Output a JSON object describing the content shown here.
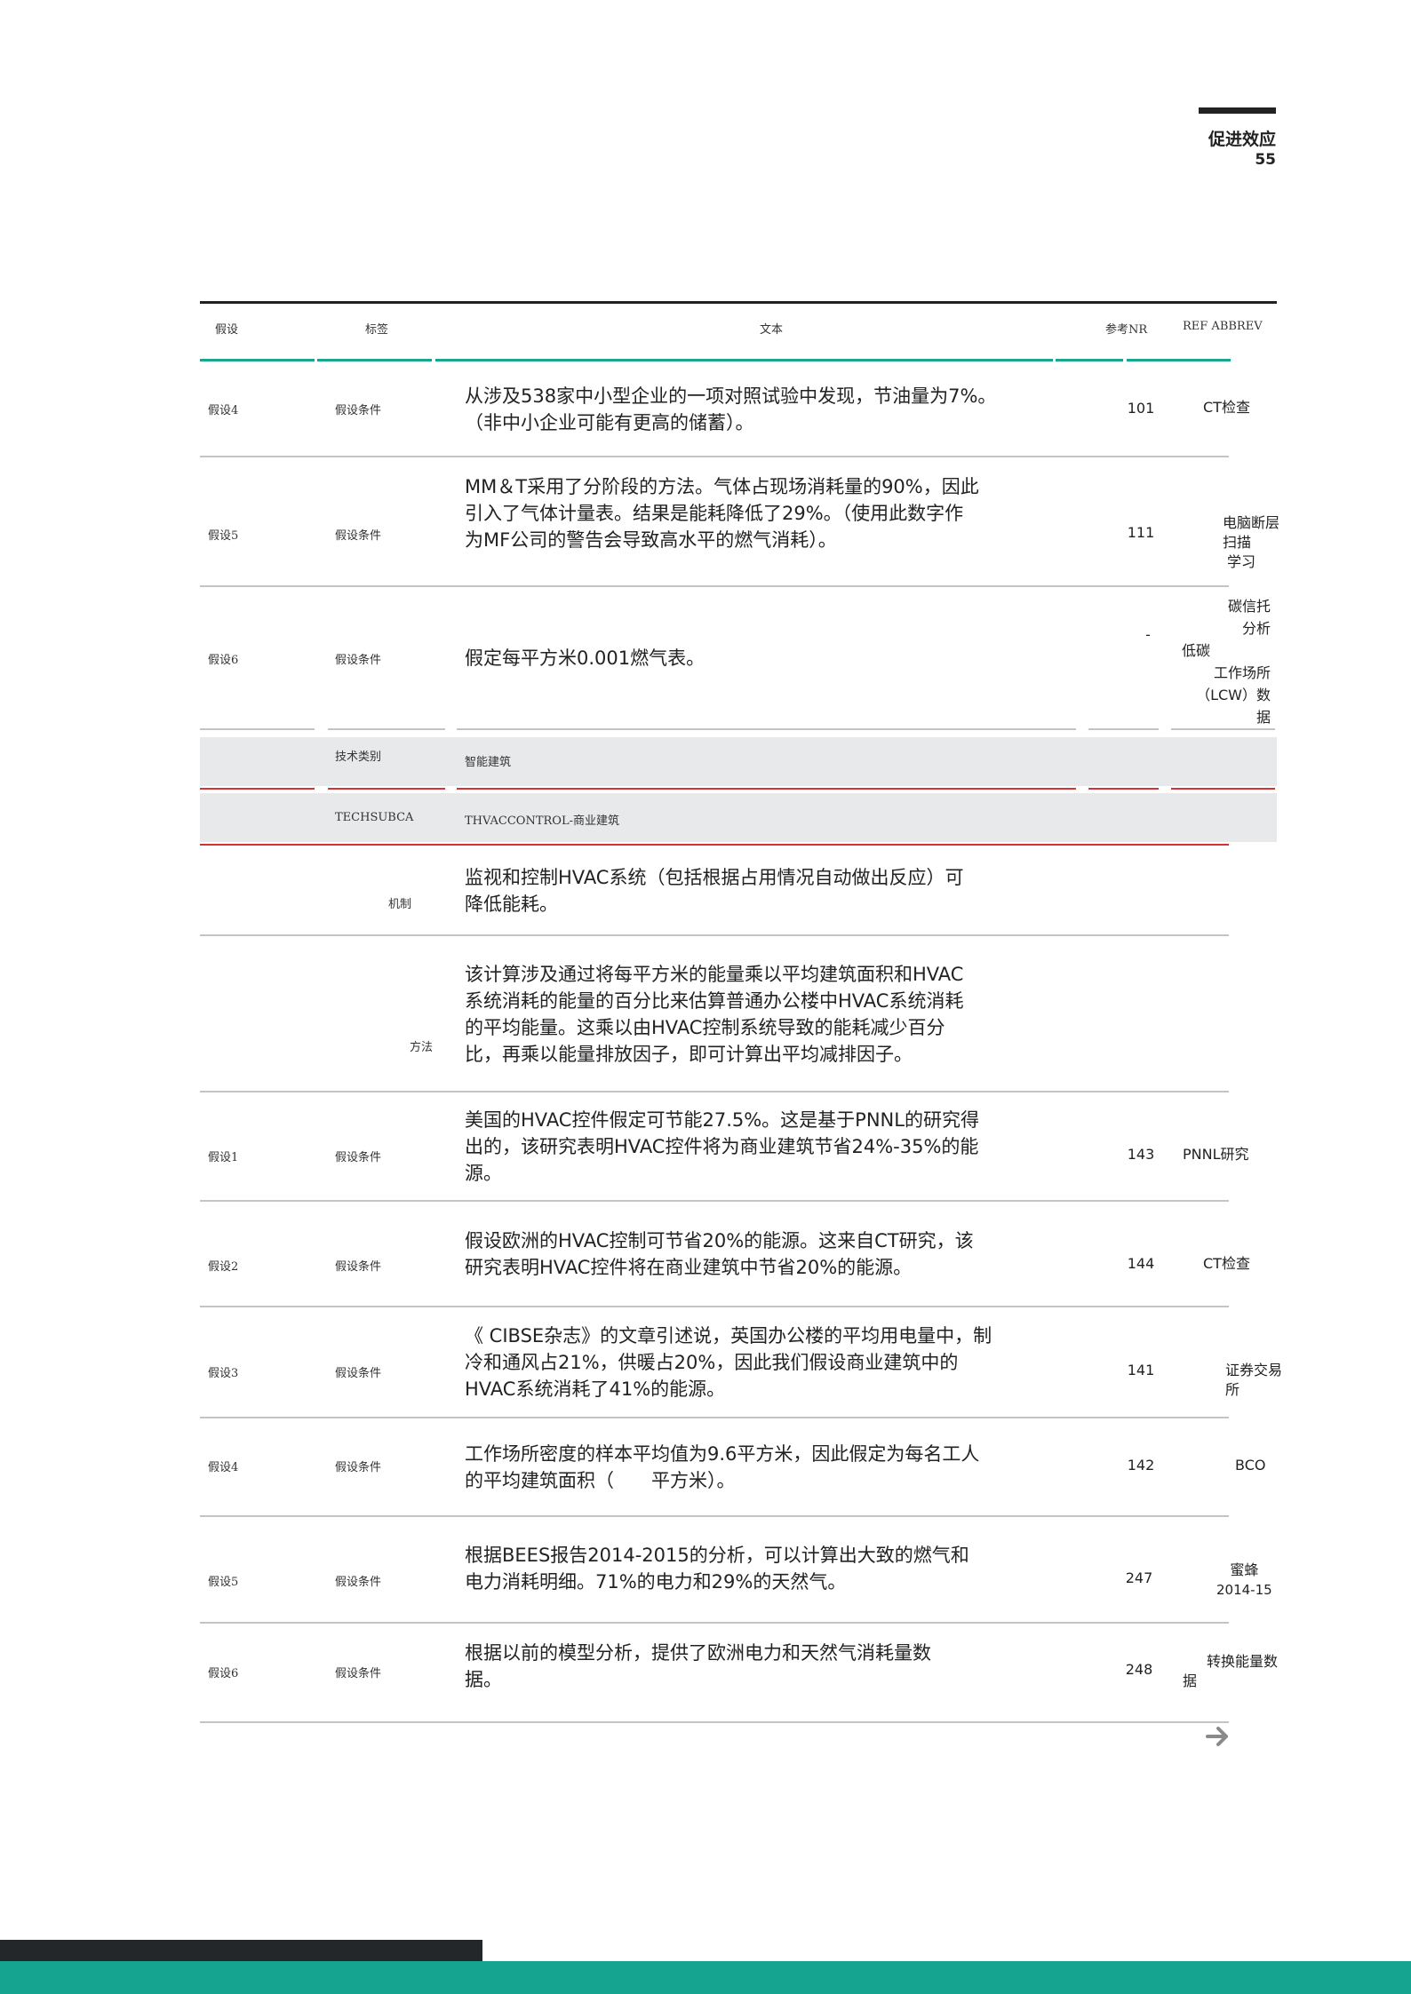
{
  "header": {
    "title": "促进效应",
    "page_number": "55"
  },
  "table": {
    "columns": [
      "假设",
      "标签",
      "文本",
      "参考NR",
      "REF ABBREV"
    ],
    "rows_a": [
      {
        "id": "假设4",
        "label": "假设条件",
        "text": [
          "从涉及538家中小型企业的一项对照试验中发现，节油量为7%。",
          "（非中小企业可能有更高的储蓄）。"
        ],
        "nr": "101",
        "ref": [
          "CT检查"
        ]
      },
      {
        "id": "假设5",
        "label": "假设条件",
        "text": [
          "MM＆T采用了分阶段的方法。气体占现场消耗量的90%，因此",
          "引入了气体计量表。结果是能耗降低了29%。（使用此数字作",
          "为MF公司的警告会导致高水平的燃气消耗）。"
        ],
        "nr": "111",
        "ref": [
          "电脑断层",
          "扫描",
          "学习"
        ]
      },
      {
        "id": "假设6",
        "label": "假设条件",
        "text": [
          "假定每平方米0.001燃气表。"
        ],
        "nr": "-",
        "ref": [
          "碳信托",
          "分析",
          "低碳",
          "工作场所",
          "（LCW）数",
          "据"
        ]
      }
    ],
    "category": {
      "label": "技术类别",
      "value": "智能建筑"
    },
    "subcategory": {
      "label": "TECHSUBCA",
      "value": "THVACCONTROL-商业建筑"
    },
    "mechanism": {
      "label": "机制",
      "text": [
        "监视和控制HVAC系统（包括根据占用情况自动做出反应）可",
        "降低能耗。"
      ]
    },
    "method": {
      "label": "方法",
      "text": [
        "该计算涉及通过将每平方米的能量乘以平均建筑面积和HVAC",
        "系统消耗的能量的百分比来估算普通办公楼中HVAC系统消耗",
        "的平均能量。这乘以由HVAC控制系统导致的能耗减少百分",
        "比，再乘以能量排放因子，即可计算出平均减排因子。"
      ]
    },
    "rows_b": [
      {
        "id": "假设1",
        "label": "假设条件",
        "text": [
          "美国的HVAC控件假定可节能27.5%。这是基于PNNL的研究得",
          "出的，该研究表明HVAC控件将为商业建筑节省24%-35%的能",
          "源。"
        ],
        "nr": "143",
        "ref": [
          "PNNL研究"
        ]
      },
      {
        "id": "假设2",
        "label": "假设条件",
        "text": [
          "假设欧洲的HVAC控制可节省20%的能源。这来自CT研究，该",
          "研究表明HVAC控件将在商业建筑中节省20%的能源。"
        ],
        "nr": "144",
        "ref": [
          "CT检查"
        ]
      },
      {
        "id": "假设3",
        "label": "假设条件",
        "text": [
          "《 CIBSE杂志》的文章引述说，英国办公楼的平均用电量中，制",
          "冷和通风占21%，供暖占20%，因此我们假设商业建筑中的",
          "HVAC系统消耗了41%的能源。"
        ],
        "nr": "141",
        "ref": [
          "证券交易",
          "所"
        ]
      },
      {
        "id": "假设4",
        "label": "假设条件",
        "text": [
          "工作场所密度的样本平均值为9.6平方米，因此假定为每名工人",
          "的平均建筑面积（　　平方米）。"
        ],
        "nr": "142",
        "ref": [
          "BCO"
        ]
      },
      {
        "id": "假设5",
        "label": "假设条件",
        "text": [
          "根据BEES报告2014-2015的分析，可以计算出大致的燃气和",
          "电力消耗明细。71%的电力和29%的天然气。"
        ],
        "nr": "247",
        "ref": [
          "蜜蜂",
          "2014-15"
        ]
      },
      {
        "id": "假设6",
        "label": "假设条件",
        "text": [
          "根据以前的模型分析，提供了欧洲电力和天然气消耗量数",
          "据。"
        ],
        "nr": "248",
        "ref": [
          "转换能量数",
          "据"
        ]
      }
    ]
  },
  "colors": {
    "teal": "#1aa58e",
    "red": "#d43434",
    "shade": "#e8e9ea",
    "footer_teal": "#14a48f",
    "footer_dark": "#23272a"
  },
  "icons": {
    "next": "arrow-right-icon"
  }
}
